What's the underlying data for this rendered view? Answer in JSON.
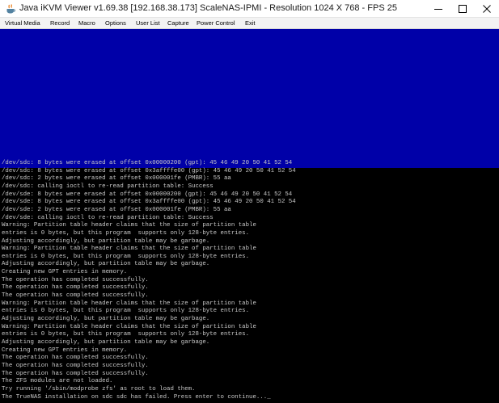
{
  "window": {
    "title": "Java iKVM Viewer v1.69.38 [192.168.38.173] ScaleNAS-IPMI - Resolution 1024 X 768 - FPS 25",
    "icon": "java-cup-icon"
  },
  "menu": {
    "items": [
      "Virtual Media",
      "Record",
      "Macro",
      "Options",
      "User List",
      "Capture",
      "Power Control",
      "Exit"
    ]
  },
  "colors": {
    "console_blue": "#0000a8",
    "console_text": "#c8c8c8",
    "console_background": "#000000"
  },
  "console": {
    "lines": [
      "/dev/sdc: 8 bytes were erased at offset 0x00000200 (gpt): 45 46 49 20 50 41 52 54",
      "/dev/sdc: 8 bytes were erased at offset 0x3affffe00 (gpt): 45 46 49 20 50 41 52 54",
      "/dev/sdc: 2 bytes were erased at offset 0x000001fe (PMBR): 55 aa",
      "/dev/sdc: calling ioctl to re-read partition table: Success",
      "/dev/sde: 8 bytes were erased at offset 0x00000200 (gpt): 45 46 49 20 50 41 52 54",
      "/dev/sde: 8 bytes were erased at offset 0x3affffe00 (gpt): 45 46 49 20 50 41 52 54",
      "/dev/sde: 2 bytes were erased at offset 0x000001fe (PMBR): 55 aa",
      "/dev/sde: calling ioctl to re-read partition table: Success",
      "Warning: Partition table header claims that the size of partition table",
      "entries is 0 bytes, but this program  supports only 128-byte entries.",
      "Adjusting accordingly, but partition table may be garbage.",
      "Warning: Partition table header claims that the size of partition table",
      "entries is 0 bytes, but this program  supports only 128-byte entries.",
      "Adjusting accordingly, but partition table may be garbage.",
      "Creating new GPT entries in memory.",
      "The operation has completed successfully.",
      "The operation has completed successfully.",
      "The operation has completed successfully.",
      "Warning: Partition table header claims that the size of partition table",
      "entries is 0 bytes, but this program  supports only 128-byte entries.",
      "Adjusting accordingly, but partition table may be garbage.",
      "Warning: Partition table header claims that the size of partition table",
      "entries is 0 bytes, but this program  supports only 128-byte entries.",
      "Adjusting accordingly, but partition table may be garbage.",
      "Creating new GPT entries in memory.",
      "The operation has completed successfully.",
      "The operation has completed successfully.",
      "The operation has completed successfully.",
      "The ZFS modules are not loaded.",
      "Try running '/sbin/modprobe zfs' as root to load them.",
      "The TrueNAS installation on sdc sdc has failed. Press enter to continue..._"
    ]
  }
}
